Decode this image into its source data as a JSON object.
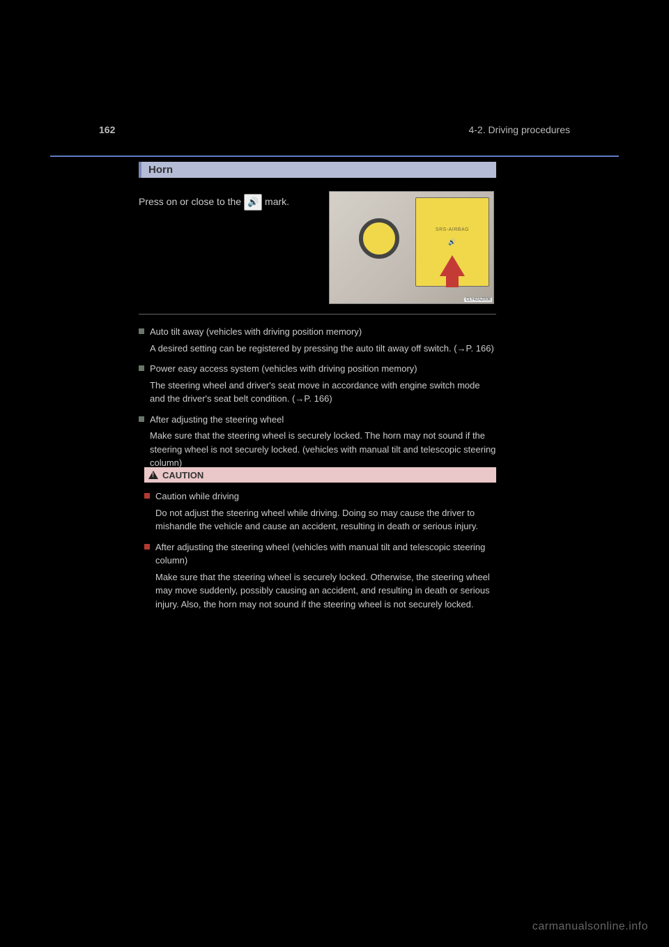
{
  "header": {
    "page_number": "162",
    "section_path": "4-2. Driving procedures"
  },
  "section": {
    "title": "Horn"
  },
  "instruction": {
    "prefix": "Press on or close to the",
    "icon_text": "🔊",
    "suffix": "mark."
  },
  "figure": {
    "airbag_label": "SRS-AIRBAG",
    "code": "CLY42AZ006"
  },
  "notes": [
    {
      "title": "Auto tilt away (vehicles with driving position memory)",
      "body": "A desired setting can be registered by pressing the auto tilt away off switch. (→P. 166)"
    },
    {
      "title": "Power easy access system (vehicles with driving position memory)",
      "body": "The steering wheel and driver's seat move in accordance with engine switch mode and the driver's seat belt condition. (→P. 166)"
    },
    {
      "title": "After adjusting the steering wheel",
      "body": "Make sure that the steering wheel is securely locked. The horn may not sound if the steering wheel is not securely locked. (vehicles with manual tilt and telescopic steering column)"
    }
  ],
  "caution": {
    "label": "CAUTION",
    "items": [
      {
        "title": "Caution while driving",
        "body": "Do not adjust the steering wheel while driving. Doing so may cause the driver to mishandle the vehicle and cause an accident, resulting in death or serious injury."
      },
      {
        "title": "After adjusting the steering wheel (vehicles with manual tilt and telescopic steering column)",
        "body": "Make sure that the steering wheel is securely locked. Otherwise, the steering wheel may move suddenly, possibly causing an accident, and resulting in death or serious injury. Also, the horn may not sound if the steering wheel is not securely locked."
      }
    ]
  },
  "watermark": "carmanualsonline.info"
}
